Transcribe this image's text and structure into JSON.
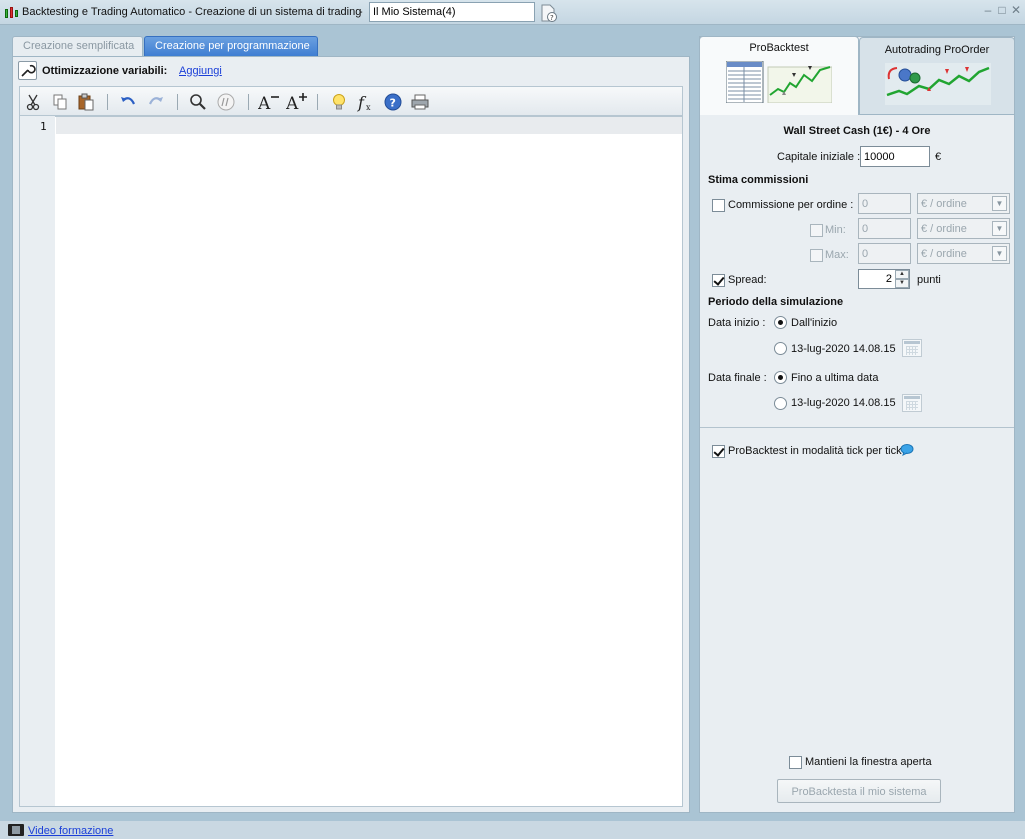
{
  "window": {
    "title": "Backtesting e Trading Automatico - Creazione di un sistema di trading",
    "separator": "-",
    "system_name": "Il Mio Sistema(4)"
  },
  "left_tabs": {
    "simple": "Creazione semplificata",
    "program": "Creazione per programmazione"
  },
  "editor": {
    "optim_label": "Ottimizzazione variabili:",
    "add_link": "Aggiungi",
    "line_number": "1",
    "toolbar_icons": [
      "scissors-icon",
      "copy-icon",
      "paste-icon",
      "undo-icon",
      "redo-icon",
      "search-icon",
      "comment-icon",
      "font-decrease-icon",
      "font-increase-icon",
      "lightbulb-icon",
      "function-icon",
      "help-icon",
      "print-icon"
    ]
  },
  "right_tabs": {
    "probacktest": "ProBacktest",
    "autotrading": "Autotrading ProOrder"
  },
  "settings": {
    "instrument": "Wall Street Cash (1€) - 4 Ore",
    "capital_label": "Capitale iniziale :",
    "capital_value": "10000",
    "currency": "€",
    "commissions_title": "Stima commissioni",
    "commission_per_order_label": "Commissione per ordine :",
    "commission_value": "0",
    "commission_unit": "€ / ordine",
    "min_label": "Min:",
    "min_value": "0",
    "min_unit": "€ / ordine",
    "max_label": "Max:",
    "max_value": "0",
    "max_unit": "€ / ordine",
    "spread_label": "Spread:",
    "spread_value": "2",
    "spread_unit": "punti",
    "period_title": "Periodo della simulazione",
    "start_label": "Data inizio :",
    "start_option1": "Dall'inizio",
    "start_option2": "13-lug-2020 14.08.15",
    "end_label": "Data finale :",
    "end_option1": "Fino a ultima data",
    "end_option2": "13-lug-2020 14.08.15",
    "tick_mode_label": "ProBacktest in modalità tick per tick",
    "keep_open_label": "Mantieni la finestra aperta",
    "run_button": "ProBacktesta il mio sistema"
  },
  "footer": {
    "video_link": "Video formazione"
  },
  "colors": {
    "active_tab": "#3f7ed2",
    "link": "#1b3fd8",
    "background": "#aac4d4"
  }
}
